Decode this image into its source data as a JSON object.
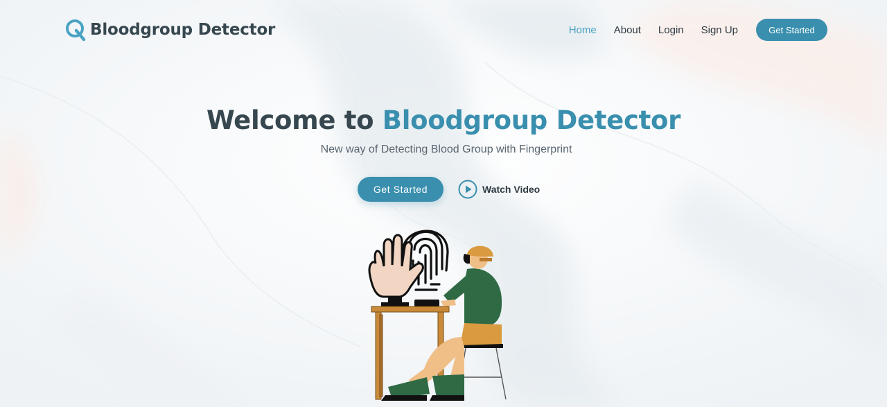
{
  "brand": {
    "name": "Bloodgroup Detector",
    "icon": "logo-q-icon",
    "accent_color": "#3a8fae"
  },
  "nav": {
    "items": [
      {
        "label": "Home",
        "active": true
      },
      {
        "label": "About",
        "active": false
      },
      {
        "label": "Login",
        "active": false
      },
      {
        "label": "Sign Up",
        "active": false
      }
    ],
    "cta_label": "Get Started"
  },
  "hero": {
    "title_prefix": "Welcome to ",
    "title_accent": "Bloodgroup Detector",
    "subtitle": "New way of Detecting Blood Group with Fingerprint",
    "primary_label": "Get Started",
    "secondary_label": "Watch Video",
    "secondary_icon": "play-icon",
    "illustration": "fingerprint-scanner-illustration"
  }
}
